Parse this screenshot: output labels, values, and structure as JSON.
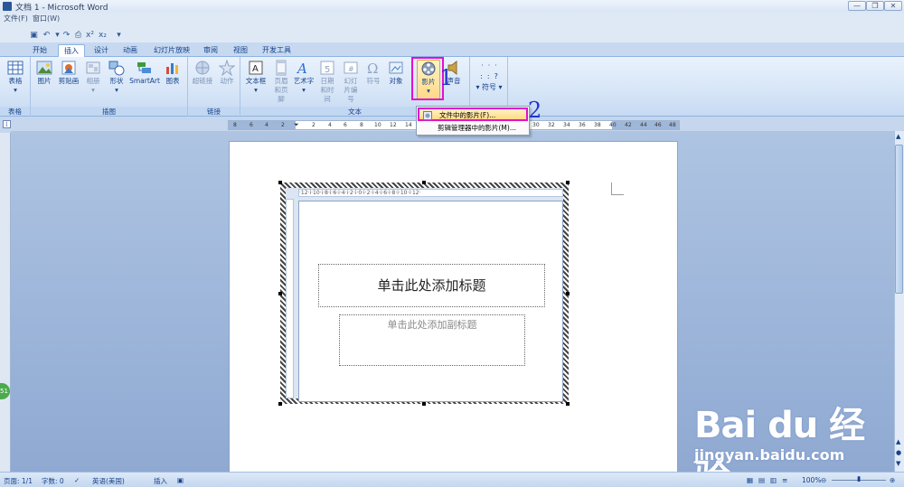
{
  "window": {
    "title": "文档 1 - Microsoft Word",
    "controls": [
      "—",
      "❐",
      "✕"
    ]
  },
  "menu": [
    "文件(F)",
    "窗口(W)"
  ],
  "tabs": [
    "开始",
    "插入",
    "设计",
    "动画",
    "幻灯片放映",
    "审阅",
    "视图",
    "开发工具"
  ],
  "active_tab": "插入",
  "ribbon": {
    "groups": {
      "tables": "表格",
      "illustrations": "插图",
      "links": "链接",
      "text": "文本"
    },
    "buttons": {
      "table": "表格",
      "picture": "图片",
      "clipart": "剪贴画",
      "album": "相册",
      "shapes": "形状",
      "smartart": "SmartArt",
      "chart": "图表",
      "hyperlink": "超链接",
      "action": "动作",
      "textbox": "文本框",
      "header_footer": "页眉和页脚",
      "wordart": "艺术字",
      "datetime": "日期和时间",
      "slide_number": "幻灯片编号",
      "symbol": "符号",
      "object": "对象",
      "movie": "影片",
      "sound": "声音",
      "symbols_menu": "符号"
    }
  },
  "dropdown": {
    "items": [
      "文件中的影片(F)...",
      "剪辑管理器中的影片(M)..."
    ]
  },
  "annotations": [
    "1",
    "2"
  ],
  "ruler_ticks": [
    "8",
    "6",
    "4",
    "2",
    "2",
    "4",
    "6",
    "8",
    "10",
    "12",
    "14",
    "30",
    "32",
    "34",
    "36",
    "38",
    "40",
    "42",
    "44",
    "46",
    "48"
  ],
  "slide": {
    "ruler_text": "·12·i·10·i·8·i·6·i·4·i·2·i·0·i·2·i·4·i·6·i·8·i·10·i·12·",
    "title_placeholder": "单击此处添加标题",
    "subtitle_placeholder": "单击此处添加副标题"
  },
  "status": {
    "page": "页面: 1/1",
    "words": "字数: 0",
    "language": "英语(美国)",
    "mode": "插入",
    "zoom": "100%",
    "badge": "51"
  },
  "watermark": {
    "brand": "Bai du 经验",
    "url": "jingyan.baidu.com"
  }
}
